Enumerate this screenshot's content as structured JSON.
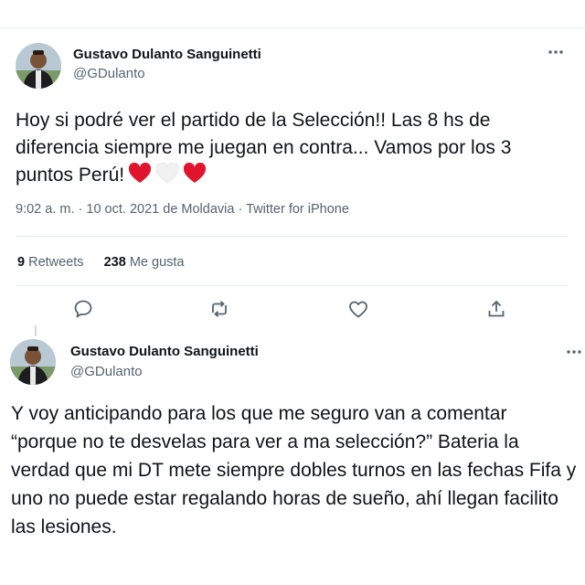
{
  "tweets": [
    {
      "author_name": "Gustavo Dulanto Sanguinetti",
      "handle": "@GDulanto",
      "more_label": "•••",
      "text": "Hoy si podré ver el partido de la Selección!! Las 8 hs de diferencia siempre me juegan en contra... Vamos por los 3 puntos Perú!",
      "emoji": [
        "red-heart",
        "white-heart",
        "red-heart"
      ],
      "time": "9:02 a. m.",
      "date": "10 oct. 2021",
      "location": "de Moldavia",
      "source": "Twitter for iPhone",
      "retweets_count": "9",
      "retweets_label": "Retweets",
      "likes_count": "238",
      "likes_label": "Me gusta",
      "actions": [
        "reply-icon",
        "retweet-icon",
        "like-icon",
        "share-icon"
      ]
    },
    {
      "author_name": "Gustavo Dulanto Sanguinetti",
      "handle": "@GDulanto",
      "more_label": "•••",
      "text": "Y voy anticipando para los que me seguro van a comentar “porque no te desvelas para ver a ma selección?” Bateria la verdad que mi DT mete siempre dobles turnos en las fechas Fifa y uno no puede estar regalando horas de sueño, ahí llegan facilito las lesiones."
    }
  ],
  "separator": "·",
  "colors": {
    "heart_red": "#e0142d",
    "heart_white": "#f2f2f2",
    "text": "#0f1419",
    "muted": "#536471"
  }
}
